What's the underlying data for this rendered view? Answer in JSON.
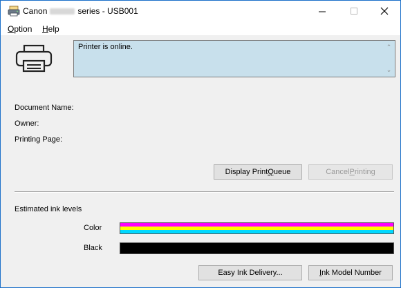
{
  "window": {
    "title_prefix": "Canon",
    "title_suffix": "series - USB001",
    "controls": {
      "minimize": "—",
      "maximize": "☐",
      "close": "✕"
    }
  },
  "menu": {
    "items": [
      {
        "label": "Option",
        "accel": "O",
        "rest": "ption"
      },
      {
        "label": "Help",
        "accel": "H",
        "rest": "elp"
      }
    ]
  },
  "status": {
    "message": "Printer is online."
  },
  "fields": {
    "document_name_label": "Document Name:",
    "owner_label": "Owner:",
    "printing_page_label": "Printing Page:"
  },
  "buttons": {
    "display_print_queue": {
      "label": "Display Print Queue",
      "pre": "Display Print ",
      "accel": "Q",
      "post": "ueue"
    },
    "cancel_printing": {
      "label": "Cancel Printing",
      "pre": "Cancel ",
      "accel": "P",
      "post": "rinting"
    }
  },
  "ink": {
    "section_label": "Estimated ink levels",
    "levels": [
      {
        "label": "Color",
        "fill": 1.0,
        "colors": [
          "#ff00ff",
          "#ffff00",
          "#00d8ff"
        ]
      },
      {
        "label": "Black",
        "fill": 1.0,
        "colors": [
          "#000000"
        ]
      }
    ]
  },
  "bottom_buttons": {
    "easy_ink_delivery": {
      "label": "Easy Ink Delivery..."
    },
    "ink_model_number": {
      "label": "Ink Model Number",
      "accel": "I",
      "rest": "nk Model Number"
    }
  }
}
